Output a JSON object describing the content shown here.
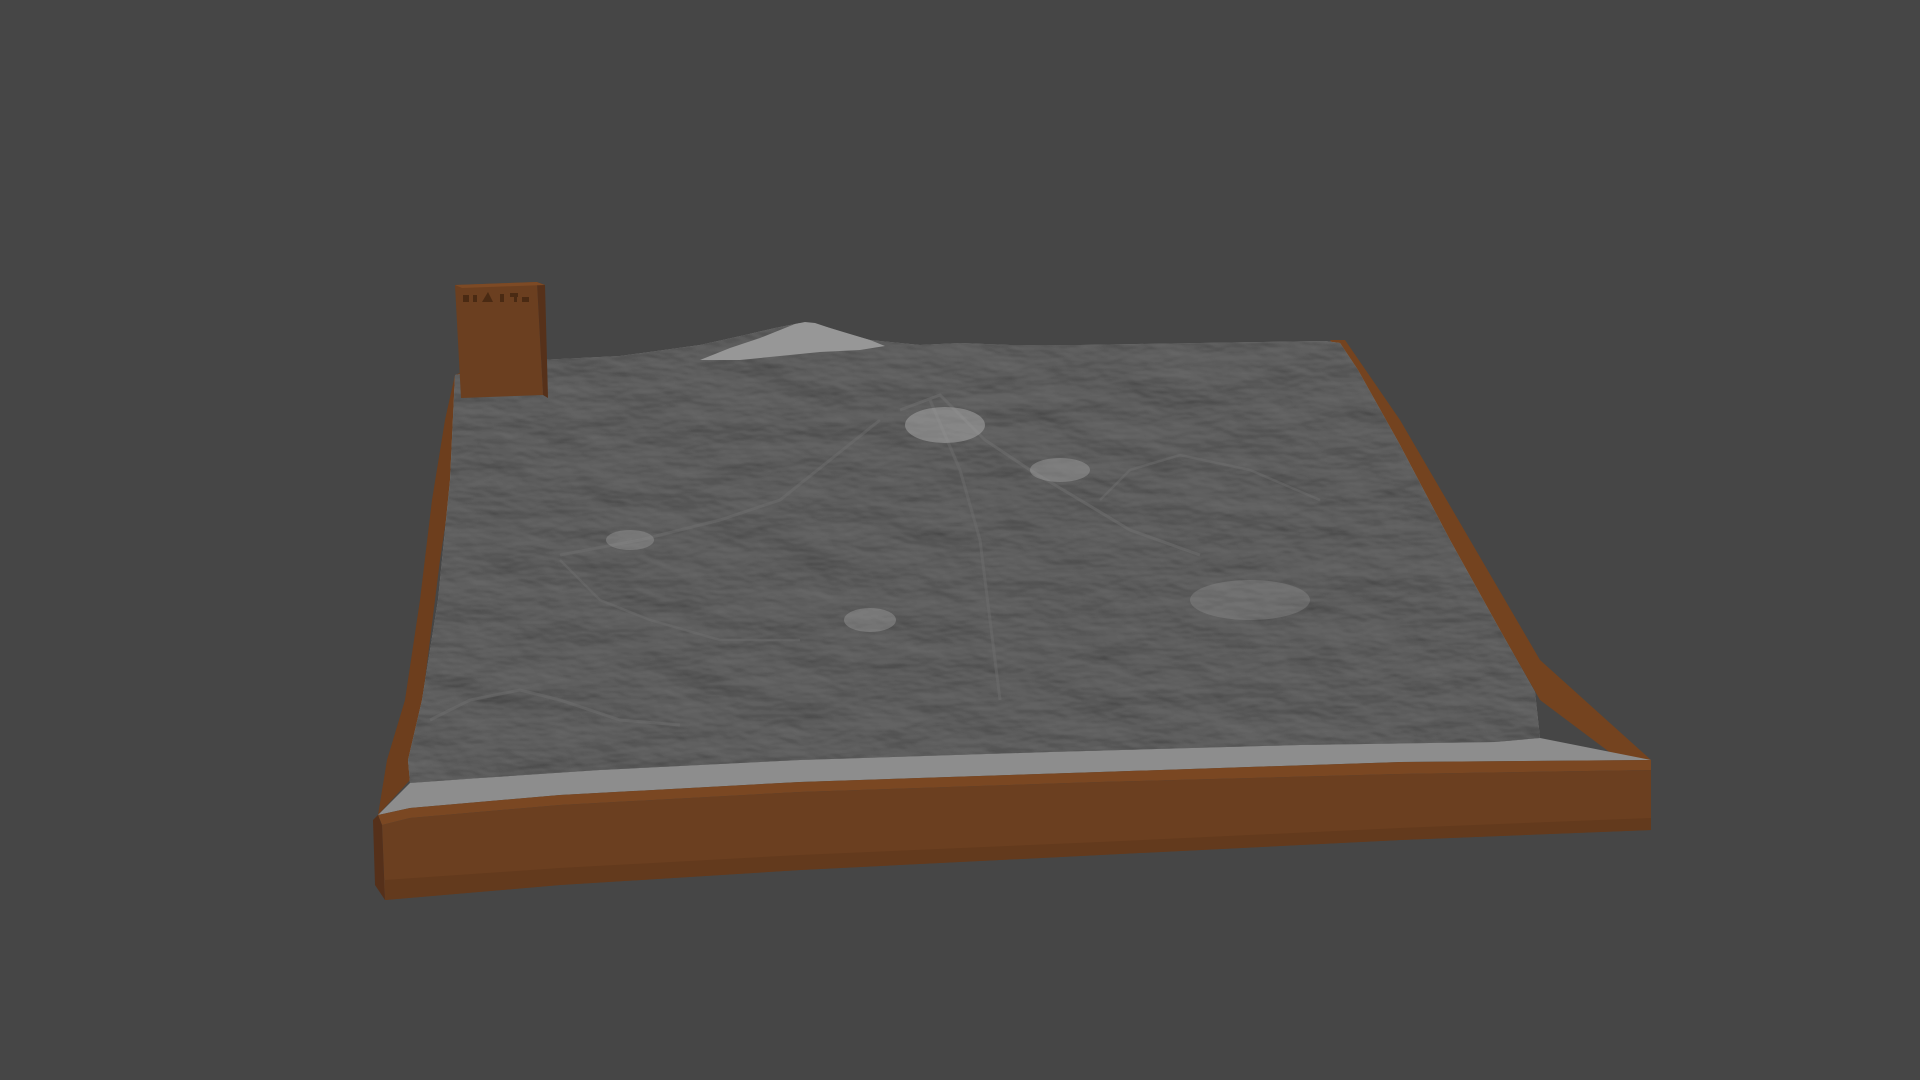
{
  "viewport": {
    "background_color": "#464646"
  },
  "model": {
    "terrain_color": "#8c8c8c",
    "base_color": "#6b3f20",
    "base_front_color": "#6d4020",
    "base_side_color": "#5a3318",
    "label_block_color": "#6b3f20"
  }
}
